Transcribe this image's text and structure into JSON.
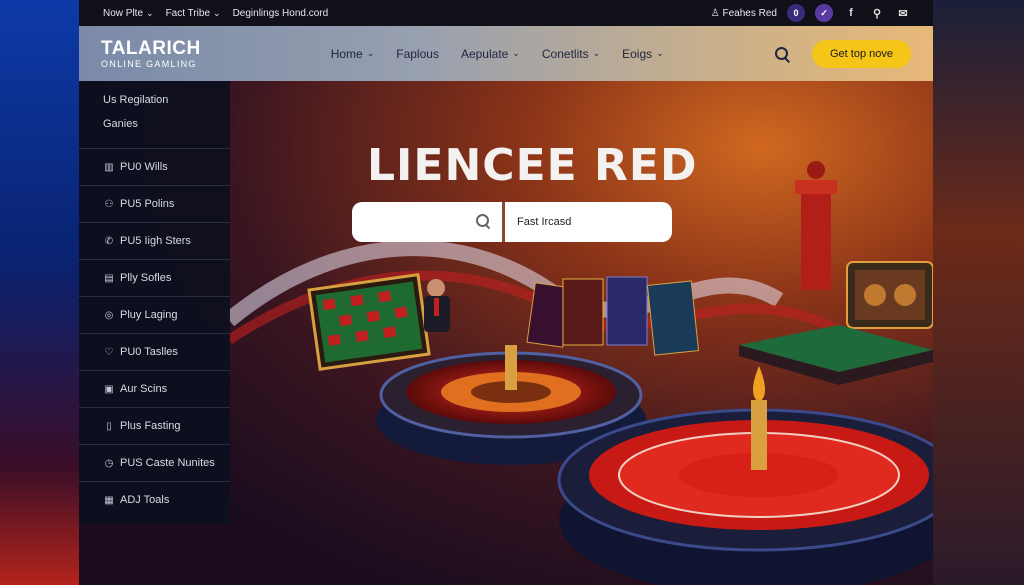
{
  "topbar": {
    "links": [
      "Now Plte",
      "Fact Tribe",
      "Deginlings Hond.cord"
    ],
    "account": "Feahes Red",
    "badge": "0",
    "check": "✓",
    "icons": [
      "facebook-icon",
      "user-icon",
      "mail-icon"
    ]
  },
  "header": {
    "logo_line1": "TALARICH",
    "logo_line2": "ONLINE GAMLING",
    "nav": [
      {
        "label": "Home",
        "dropdown": true
      },
      {
        "label": "Faplous",
        "dropdown": false
      },
      {
        "label": "Aepulate",
        "dropdown": true
      },
      {
        "label": "Conetlits",
        "dropdown": true
      },
      {
        "label": "Eoigs",
        "dropdown": true
      }
    ],
    "cta": "Get top nove"
  },
  "sidebar": {
    "head": [
      "Us Regilation",
      "Ganies"
    ],
    "items": [
      {
        "icon": "▥",
        "label": "PU0 Wills"
      },
      {
        "icon": "⚇",
        "label": "PU5 Polins"
      },
      {
        "icon": "✆",
        "label": "PU5 Iigh Sters"
      },
      {
        "icon": "▤",
        "label": "Plly Sofles"
      },
      {
        "icon": "◎",
        "label": "Pluy Laging"
      },
      {
        "icon": "♡",
        "label": "PU0 Taslles"
      },
      {
        "icon": "▣",
        "label": "Aur Scins"
      },
      {
        "icon": "▯",
        "label": "Plus Fasting"
      },
      {
        "icon": "◷",
        "label": "PUS Caste Nunites"
      },
      {
        "icon": "▦",
        "label": "ADJ Toals"
      }
    ]
  },
  "hero": {
    "title": "LIENCEE RED",
    "search_button": "Fast Ircasd"
  },
  "colors": {
    "accent": "#f5c518",
    "sidebar": "#0e101e",
    "topbar": "#0f1018"
  }
}
